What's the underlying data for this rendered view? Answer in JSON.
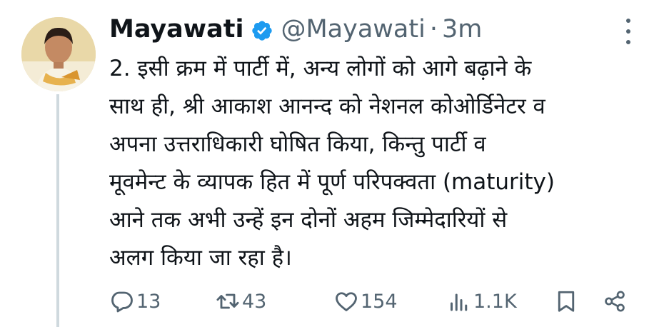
{
  "tweet": {
    "author_name": "Mayawati",
    "author_handle": "@Mayawati",
    "separator": "·",
    "time": "3m",
    "text_lines": [
      "2. इसी क्रम में पार्टी में, अन्य लोगों को आगे बढ़ाने के",
      "साथ ही, श्री आकाश आनन्द को नेशनल कोओर्डिनेटर व",
      "अपना उत्तराधिकारी घोषित किया, किन्तु पार्टी व",
      "मूवमेन्ट के व्यापक हित में पूर्ण परिपक्वता (maturity)",
      "आने तक अभी उन्हें इन दोनों अहम जिम्मेदारियों से",
      "अलग किया जा रहा है।"
    ]
  },
  "actions": {
    "replies": "13",
    "reposts": "43",
    "likes": "154",
    "views": "1.1K"
  },
  "icons": {
    "verified": "verified-badge-icon",
    "more": "more-options-icon",
    "reply": "reply-icon",
    "repost": "repost-icon",
    "like": "heart-icon",
    "views": "views-chart-icon",
    "bookmark": "bookmark-icon",
    "share": "share-icon"
  },
  "colors": {
    "text": "#0f1419",
    "secondary": "#536471",
    "verified_blue": "#1d9bf0",
    "thread_line": "#cfd9de"
  }
}
